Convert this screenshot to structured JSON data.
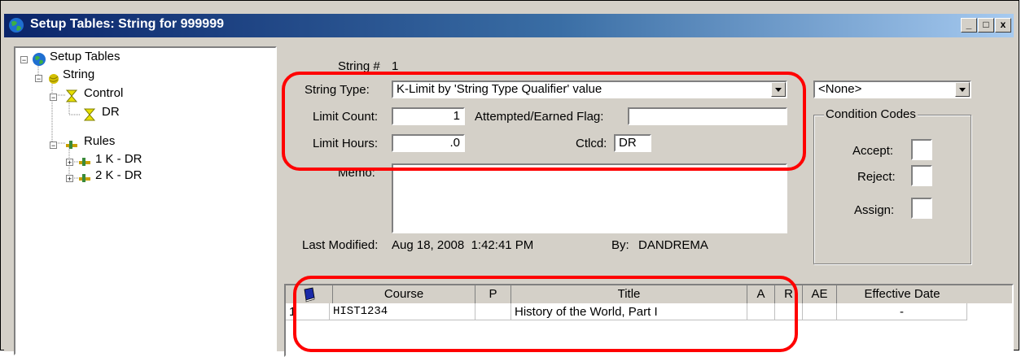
{
  "window": {
    "title": "Setup Tables: String for 999999",
    "minimize": "_",
    "maximize": "□",
    "close": "x"
  },
  "tree": {
    "root": "Setup Tables",
    "string": "String",
    "control": "Control",
    "dr": "DR",
    "rules": "Rules",
    "rule1": "1 K - DR",
    "rule2": "2 K - DR"
  },
  "form": {
    "string_no_label": "String #",
    "string_no": "1",
    "string_type_label": "String Type:",
    "string_type_value": "K-Limit by 'String Type Qualifier' value",
    "limit_count_label": "Limit Count:",
    "limit_count_value": "1",
    "attempted_label": "Attempted/Earned Flag:",
    "attempted_value": "",
    "limit_hours_label": "Limit Hours:",
    "limit_hours_value": ".0",
    "ctlcd_label": "Ctlcd:",
    "ctlcd_value": "DR",
    "memo_label": "Memo:",
    "memo_value": "",
    "last_modified_label": "Last Modified:",
    "last_modified_value": "Aug 18, 2008  1:42:41 PM",
    "by_label": "By:",
    "by_value": "DANDREMA"
  },
  "side": {
    "none_select": "<None>",
    "condition_codes": "Condition Codes",
    "accept_label": "Accept:",
    "reject_label": "Reject:",
    "assign_label": "Assign:"
  },
  "grid": {
    "headers": [
      "Course",
      "P",
      "Title",
      "A",
      "R",
      "AE",
      "Effective Date"
    ],
    "rows": [
      {
        "num": "1",
        "course": "HIST1234",
        "p": "",
        "title": "History of the World, Part I",
        "a": "",
        "r": "",
        "ae": "",
        "effective": "-"
      }
    ]
  },
  "colors": {
    "title_gradient_start": "#0a246a",
    "highlight": "#ff0000",
    "face": "#d4d0c8"
  }
}
